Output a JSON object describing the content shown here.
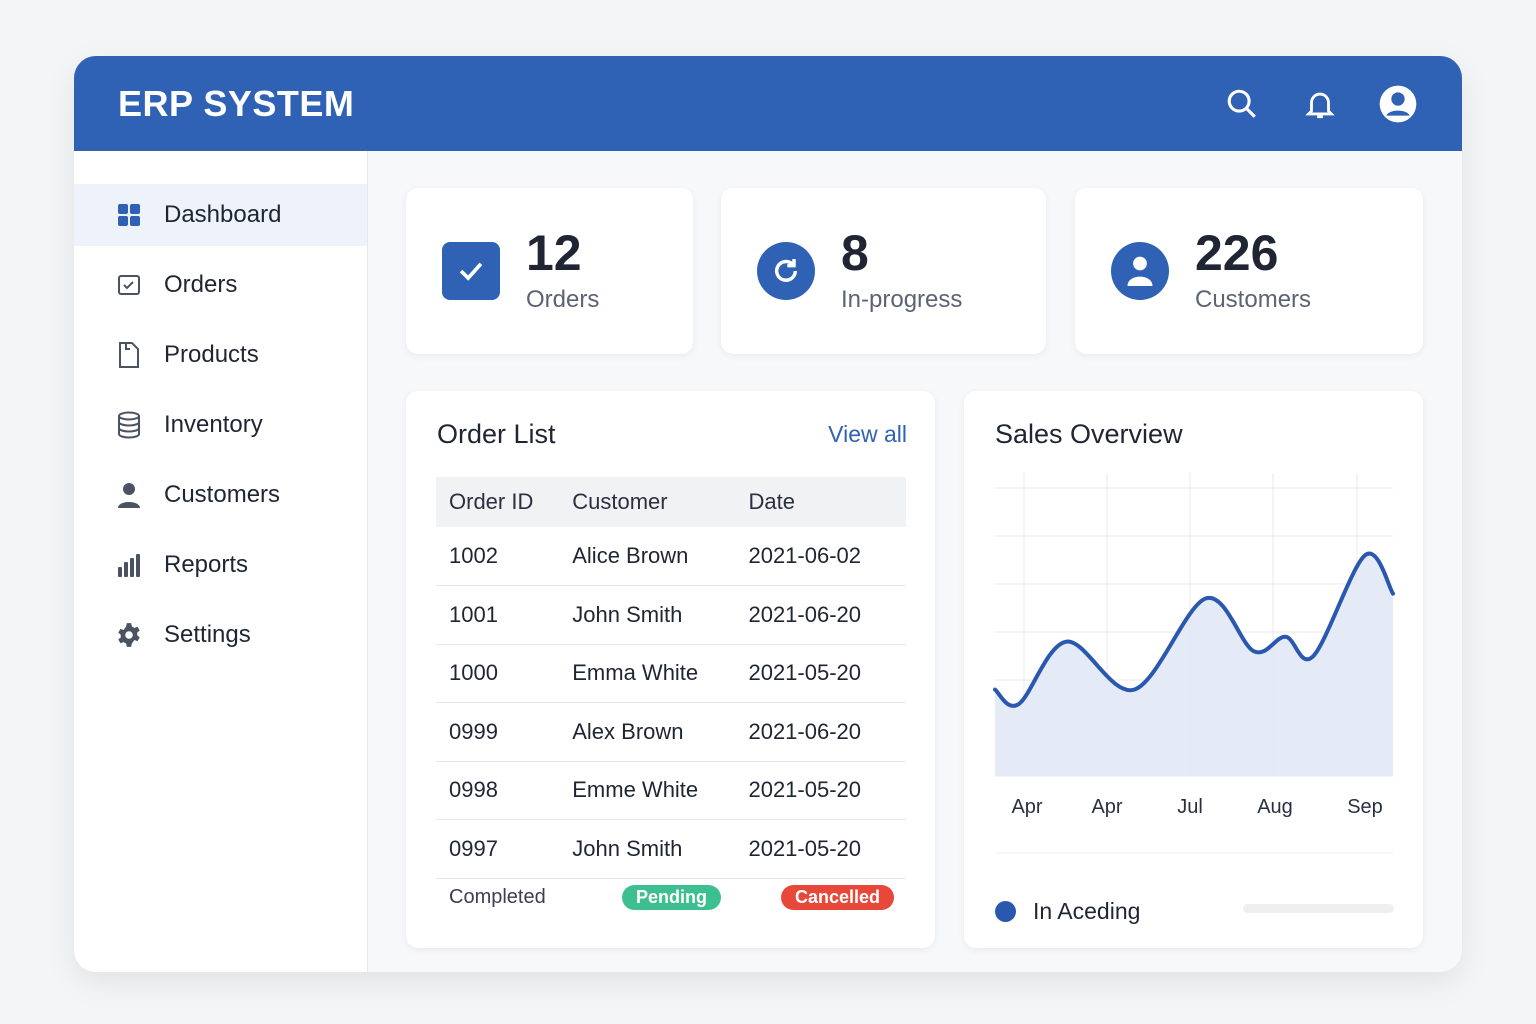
{
  "header": {
    "title": "ERP SYSTEM",
    "icons": [
      "search-icon",
      "bell-icon",
      "user-avatar-icon"
    ]
  },
  "sidebar": {
    "items": [
      {
        "label": "Dashboard",
        "icon": "grid-icon",
        "active": true
      },
      {
        "label": "Orders",
        "icon": "checkbox-icon"
      },
      {
        "label": "Products",
        "icon": "document-icon"
      },
      {
        "label": "Inventory",
        "icon": "database-icon"
      },
      {
        "label": "Customers",
        "icon": "person-icon"
      },
      {
        "label": "Reports",
        "icon": "bar-chart-icon"
      },
      {
        "label": "Settings",
        "icon": "gear-icon"
      }
    ]
  },
  "stats": [
    {
      "value": "12",
      "label": "Orders",
      "icon": "check-icon"
    },
    {
      "value": "8",
      "label": "In-progress",
      "icon": "refresh-icon"
    },
    {
      "value": "226",
      "label": "Customers",
      "icon": "user-icon"
    }
  ],
  "orders": {
    "title": "Order List",
    "view_all": "View all",
    "columns": [
      "Order ID",
      "Customer",
      "Date"
    ],
    "rows": [
      [
        "1002",
        "Alice Brown",
        "2021-06-02"
      ],
      [
        "1001",
        "John Smith",
        "2021-06-20"
      ],
      [
        "1000",
        "Emma White",
        "2021-05-20"
      ],
      [
        "0999",
        "Alex Brown",
        "2021-06-20"
      ],
      [
        "0998",
        "Emme White",
        "2021-05-20"
      ],
      [
        "0997",
        "John Smith",
        "2021-05-20"
      ]
    ],
    "statuses": {
      "completed": "Completed",
      "pending": "Pending",
      "cancelled": "Cancelled"
    },
    "colors": {
      "pending": "#3dbf92",
      "cancelled": "#e8483a"
    }
  },
  "sales": {
    "title": "Sales Overview",
    "legend": "In Aceding"
  },
  "chart_data": {
    "type": "area",
    "title": "Sales Overview",
    "x_labels": [
      "Apr",
      "Apr",
      "Jul",
      "Aug",
      "Sep"
    ],
    "x": [
      0,
      6,
      18,
      35,
      53,
      65,
      73,
      80,
      93,
      100
    ],
    "y": [
      18,
      15,
      28,
      18,
      37,
      26,
      29,
      25,
      46,
      38
    ],
    "ylim": [
      0,
      60
    ],
    "xlim": [
      0,
      100
    ],
    "grid": true,
    "series_name": "In Aceding",
    "color": "#2a58b0"
  }
}
